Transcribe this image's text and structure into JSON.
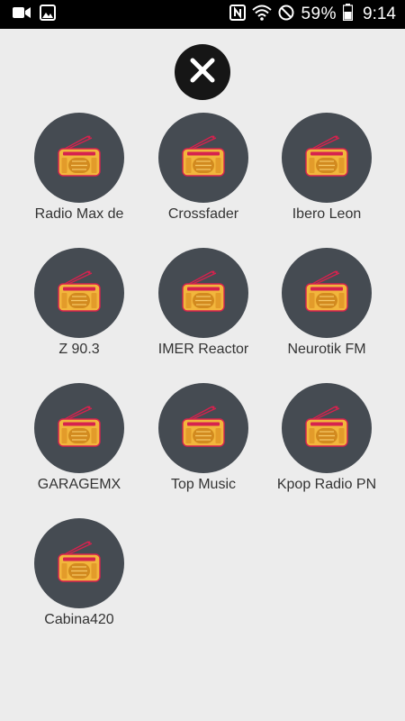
{
  "status_bar": {
    "icons_left": [
      "video-camera-icon",
      "gallery-icon"
    ],
    "icons_right": [
      "nfc-icon",
      "wifi-icon",
      "do-not-disturb-icon"
    ],
    "battery_percent": "59%",
    "battery_icon": "battery-icon",
    "time": "9:14"
  },
  "close_button": {
    "icon": "close-icon"
  },
  "stations": [
    {
      "name": "Radio Max de",
      "icon": "radio-icon"
    },
    {
      "name": "Crossfader",
      "icon": "radio-icon"
    },
    {
      "name": "Ibero Leon",
      "icon": "radio-icon"
    },
    {
      "name": "Z 90.3",
      "icon": "radio-icon"
    },
    {
      "name": "IMER Reactor",
      "icon": "radio-icon"
    },
    {
      "name": "Neurotik FM",
      "icon": "radio-icon"
    },
    {
      "name": "GARAGEMX",
      "icon": "radio-icon"
    },
    {
      "name": "Top Music",
      "icon": "radio-icon"
    },
    {
      "name": "Kpop Radio PN",
      "icon": "radio-icon"
    },
    {
      "name": "Cabina420",
      "icon": "radio-icon"
    }
  ],
  "colors": {
    "background": "#ececec",
    "circle": "#454b52",
    "radio_body": "#f2b63c",
    "radio_accent": "#d6224e"
  }
}
